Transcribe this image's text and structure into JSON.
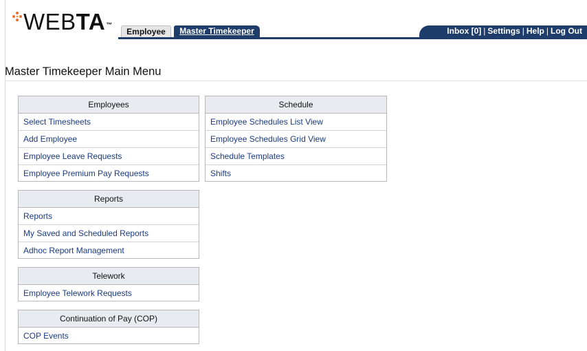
{
  "header": {
    "logo": {
      "prefix": "WEB",
      "suffix": "TA",
      "trademark": "™"
    },
    "tabs": [
      {
        "label": "Employee"
      },
      {
        "label": "Master Timekeeper"
      }
    ],
    "user_links": {
      "inbox": "Inbox [0]",
      "settings": "Settings",
      "help": "Help",
      "logout": "Log Out",
      "separator": "|"
    }
  },
  "page_title": "Master Timekeeper Main Menu",
  "menus": {
    "employees": {
      "title": "Employees",
      "items": [
        "Select Timesheets",
        "Add Employee",
        "Employee Leave Requests",
        "Employee Premium Pay Requests"
      ]
    },
    "schedule": {
      "title": "Schedule",
      "items": [
        "Employee Schedules List View",
        "Employee Schedules Grid View",
        "Schedule Templates",
        "Shifts"
      ]
    },
    "reports": {
      "title": "Reports",
      "items": [
        "Reports",
        "My Saved and Scheduled Reports",
        "Adhoc Report Management"
      ]
    },
    "telework": {
      "title": "Telework",
      "items": [
        "Employee Telework Requests"
      ]
    },
    "cop": {
      "title": "Continuation of Pay (COP)",
      "items": [
        "COP Events"
      ]
    }
  },
  "colors": {
    "navy": "#1f3d6b",
    "link": "#1a3a82",
    "logo_dot": "#e8702a",
    "panel_header": "#e8ecf0"
  }
}
